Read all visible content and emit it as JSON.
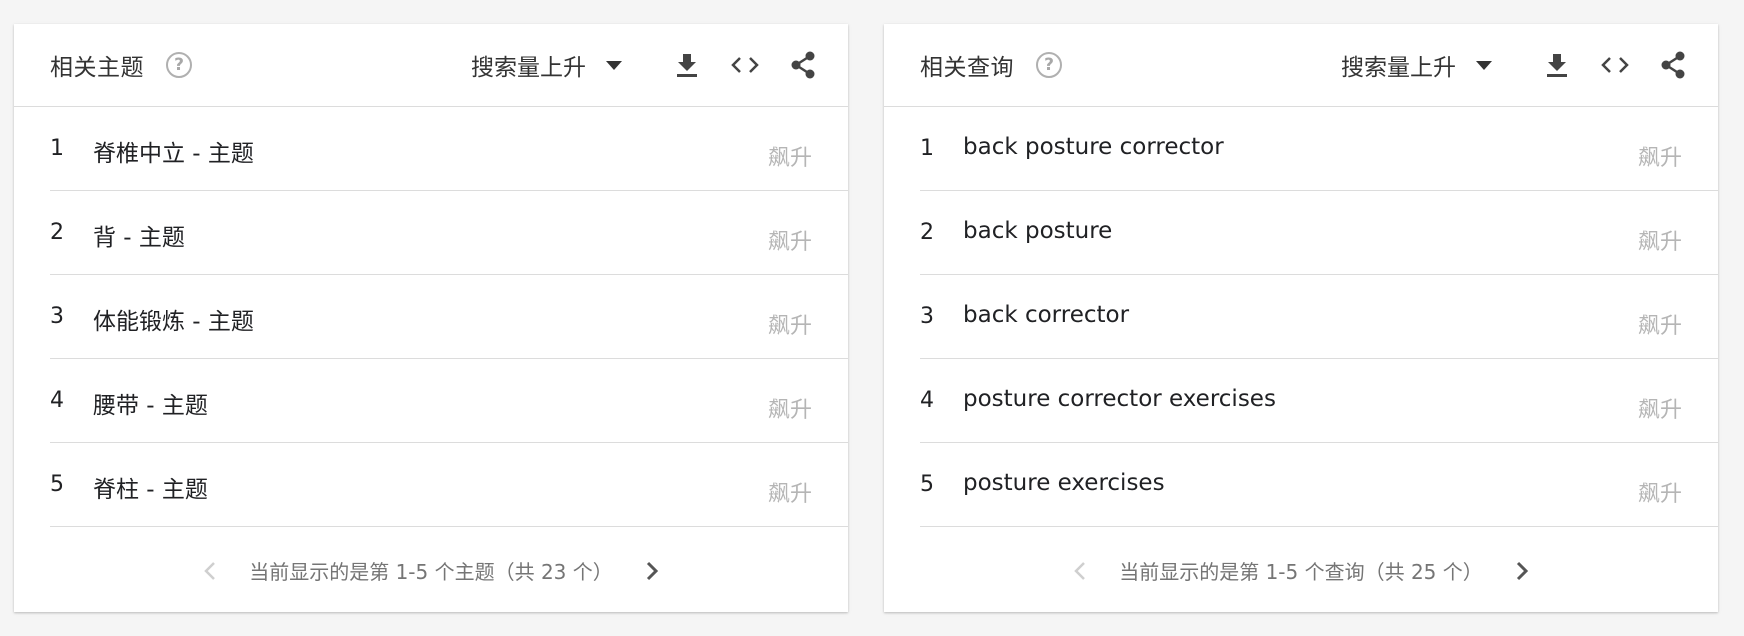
{
  "cards": [
    {
      "title": "相关主题",
      "help_glyph": "?",
      "sort_label": "搜索量上升",
      "icons": [
        "help-icon",
        "caret-down-icon",
        "download-icon",
        "embed-code-icon",
        "share-icon"
      ],
      "rows": [
        {
          "rank": "1",
          "label": "脊椎中立 - 主题",
          "value": "飙升"
        },
        {
          "rank": "2",
          "label": "背 - 主题",
          "value": "飙升"
        },
        {
          "rank": "3",
          "label": "体能锻炼 - 主题",
          "value": "飙升"
        },
        {
          "rank": "4",
          "label": "腰带 - 主题",
          "value": "飙升"
        },
        {
          "rank": "5",
          "label": "脊柱 - 主题",
          "value": "飙升"
        }
      ],
      "pager_text": "当前显示的是第 1-5 个主题（共 23 个）"
    },
    {
      "title": "相关查询",
      "help_glyph": "?",
      "sort_label": "搜索量上升",
      "icons": [
        "help-icon",
        "caret-down-icon",
        "download-icon",
        "embed-code-icon",
        "share-icon"
      ],
      "rows": [
        {
          "rank": "1",
          "label": "back posture corrector",
          "value": "飙升"
        },
        {
          "rank": "2",
          "label": "back posture",
          "value": "飙升"
        },
        {
          "rank": "3",
          "label": "back corrector",
          "value": "飙升"
        },
        {
          "rank": "4",
          "label": "posture corrector exercises",
          "value": "飙升"
        },
        {
          "rank": "5",
          "label": "posture exercises",
          "value": "飙升"
        }
      ],
      "pager_text": "当前显示的是第 1-5 个查询（共 25 个）"
    }
  ],
  "colors": {
    "background": "#f5f5f5",
    "card": "#ffffff",
    "text": "#202124",
    "muted": "#b5b5b5",
    "divider": "#dcdcdc"
  }
}
